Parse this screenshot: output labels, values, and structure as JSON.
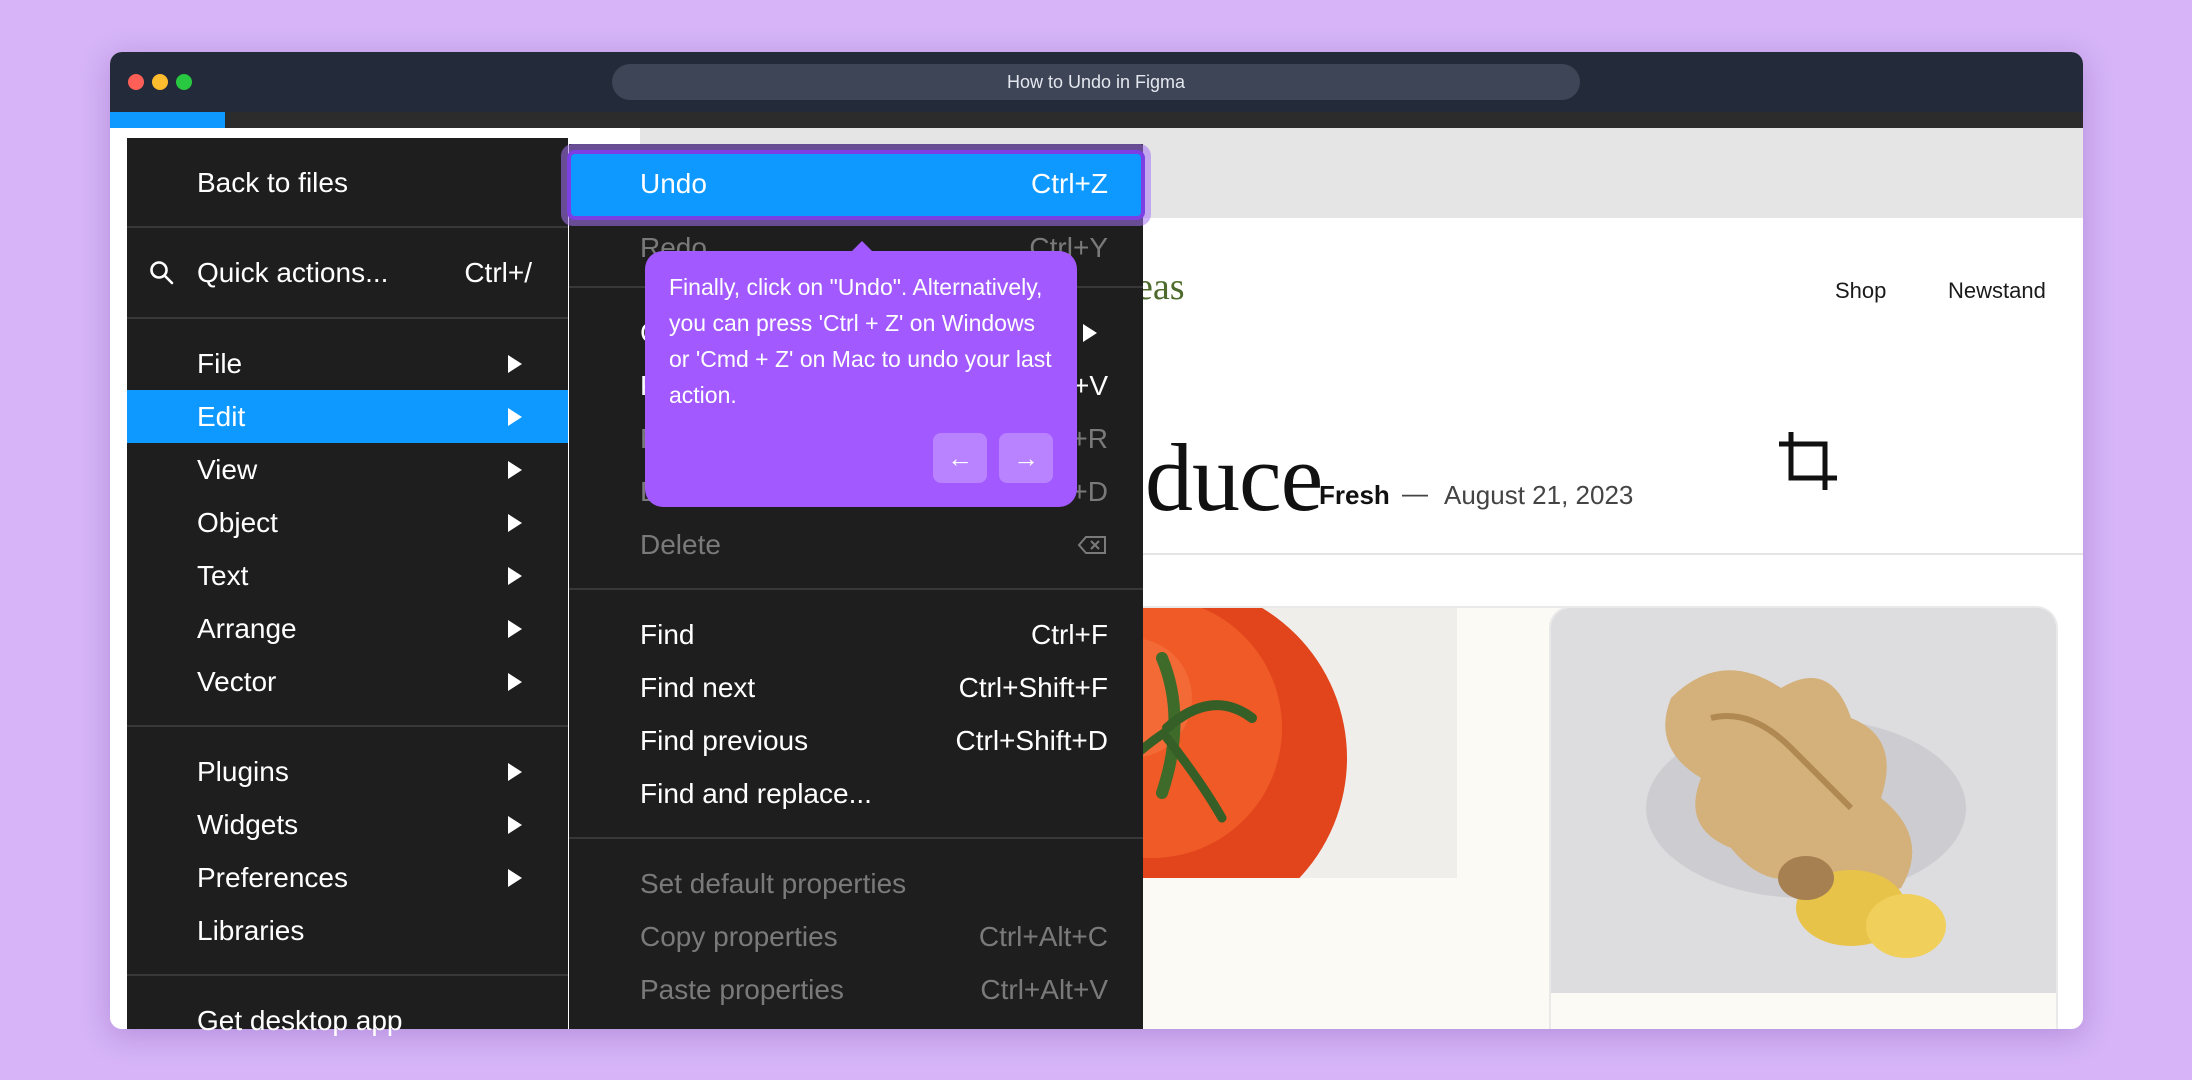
{
  "window": {
    "title": "How to Undo in Figma"
  },
  "colors": {
    "background": "#d6b4f7",
    "menu_bg": "#1e1e1e",
    "accent_blue": "#0d99ff",
    "tooltip_purple": "#a259ff",
    "dim_text": "#7a7a7a"
  },
  "page": {
    "logo_fragment": "eas",
    "nav": [
      "Shop",
      "Newstand"
    ],
    "headline_fragment": "duce",
    "tag": "Fresh",
    "dash": "—",
    "date": "August 21, 2023"
  },
  "main_menu": {
    "back": "Back to files",
    "quick_actions": {
      "label": "Quick actions...",
      "shortcut": "Ctrl+/",
      "icon": "search-icon"
    },
    "items": [
      {
        "label": "File"
      },
      {
        "label": "Edit"
      },
      {
        "label": "View"
      },
      {
        "label": "Object"
      },
      {
        "label": "Text"
      },
      {
        "label": "Arrange"
      },
      {
        "label": "Vector"
      }
    ],
    "items2": [
      {
        "label": "Plugins"
      },
      {
        "label": "Widgets"
      },
      {
        "label": "Preferences"
      },
      {
        "label": "Libraries"
      }
    ],
    "desktop": "Get desktop app"
  },
  "edit_menu": {
    "undo": {
      "label": "Undo",
      "shortcut": "Ctrl+Z"
    },
    "redo": {
      "label": "Redo",
      "shortcut": "Ctrl+Y"
    },
    "hidden_partials": [
      {
        "label": "C",
        "shortcut": ""
      },
      {
        "label": "P",
        "shortcut": "+V"
      },
      {
        "label": "P",
        "shortcut": "+R"
      },
      {
        "label": "D",
        "shortcut": "+D"
      }
    ],
    "delete": {
      "label": "Delete",
      "icon": "delete-key-icon"
    },
    "find_items": [
      {
        "label": "Find",
        "shortcut": "Ctrl+F"
      },
      {
        "label": "Find next",
        "shortcut": "Ctrl+Shift+F"
      },
      {
        "label": "Find previous",
        "shortcut": "Ctrl+Shift+D"
      },
      {
        "label": "Find and replace...",
        "shortcut": ""
      }
    ],
    "property_items": [
      {
        "label": "Set default properties",
        "shortcut": ""
      },
      {
        "label": "Copy properties",
        "shortcut": "Ctrl+Alt+C"
      },
      {
        "label": "Paste properties",
        "shortcut": "Ctrl+Alt+V"
      }
    ]
  },
  "tooltip": {
    "text": "Finally, click on \"Undo\". Alternatively, you can press 'Ctrl + Z' on Windows or 'Cmd + Z' on Mac to undo your last action.",
    "prev": "←",
    "next": "→"
  }
}
